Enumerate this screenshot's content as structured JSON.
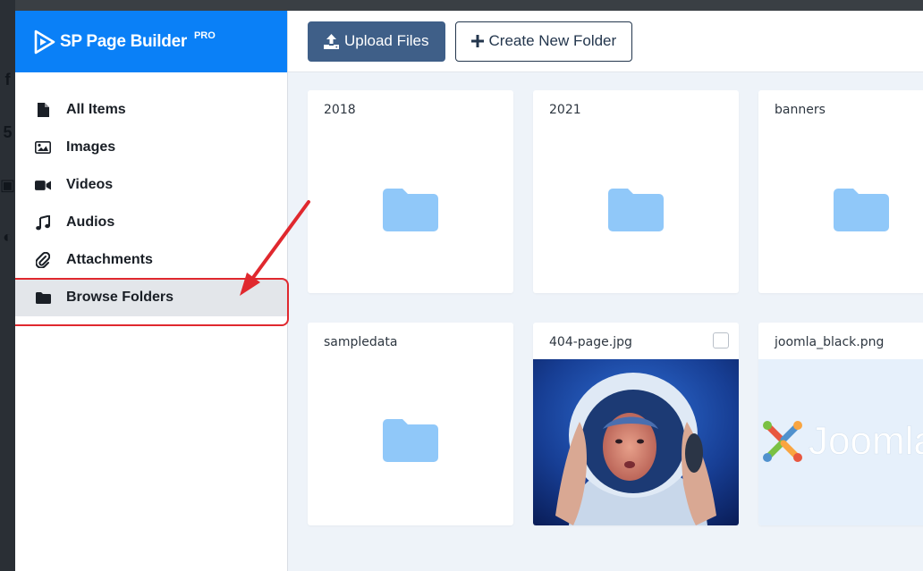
{
  "brand": {
    "name": "SP Page Builder",
    "badge": "PRO",
    "color": "#0a80f7"
  },
  "sidebar": {
    "items": [
      {
        "label": "All Items",
        "icon": "file-icon"
      },
      {
        "label": "Images",
        "icon": "image-icon"
      },
      {
        "label": "Videos",
        "icon": "video-camera-icon"
      },
      {
        "label": "Audios",
        "icon": "music-note-icon"
      },
      {
        "label": "Attachments",
        "icon": "paperclip-icon"
      },
      {
        "label": "Browse Folders",
        "icon": "folder-icon",
        "active": true
      }
    ]
  },
  "toolbar": {
    "upload_label": "Upload Files",
    "new_folder_label": "Create New Folder"
  },
  "items": [
    {
      "name": "2018",
      "type": "folder"
    },
    {
      "name": "2021",
      "type": "folder"
    },
    {
      "name": "banners",
      "type": "folder"
    },
    {
      "name": "sampledata",
      "type": "folder"
    },
    {
      "name": "404-page.jpg",
      "type": "image"
    },
    {
      "name": "joomla_black.png",
      "type": "image"
    }
  ],
  "colors": {
    "folder": "#90c8f9",
    "annotation": "#e0282e"
  }
}
